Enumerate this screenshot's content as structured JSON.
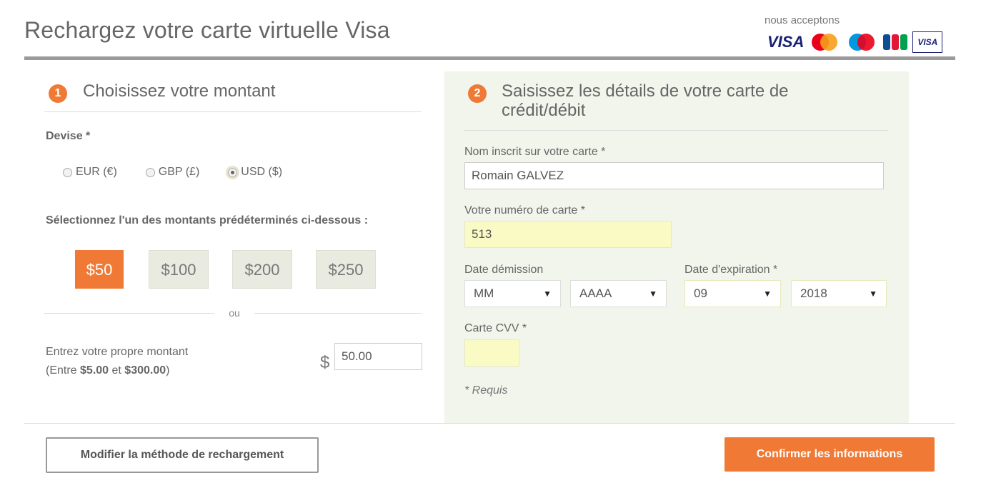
{
  "header": {
    "title": "Rechargez votre carte virtuelle Visa",
    "accept_label": "nous acceptons",
    "cards": [
      "visa-icon",
      "mastercard-icon",
      "maestro-icon",
      "jcb-icon",
      "visa-electron-icon"
    ],
    "card_texts": {
      "visa": "VISA",
      "visa_electron": "VISA"
    }
  },
  "step1": {
    "number": "1",
    "title": "Choisissez votre montant",
    "currency_label": "Devise *",
    "currencies": [
      {
        "label": "EUR (€)",
        "selected": false
      },
      {
        "label": "GBP (£)",
        "selected": false
      },
      {
        "label": "USD ($)",
        "selected": true
      }
    ],
    "preset_label": "Sélectionnez l'un des montants prédéterminés ci-dessous :",
    "presets": [
      {
        "label": "$50",
        "active": true
      },
      {
        "label": "$100",
        "active": false
      },
      {
        "label": "$200",
        "active": false
      },
      {
        "label": "$250",
        "active": false
      }
    ],
    "or_text": "ou",
    "custom_label": "Entrez votre propre montant",
    "custom_range_prefix": "(Entre ",
    "custom_min": "$5.00",
    "custom_range_mid": " et ",
    "custom_max": "$300.00",
    "custom_range_suffix": ")",
    "currency_symbol": "$",
    "custom_value": "50.00"
  },
  "step2": {
    "number": "2",
    "title_line1": "Saisissez les détails de votre carte de",
    "title_line2": "crédit/débit",
    "name_label": "Nom inscrit sur votre carte *",
    "name_value": "Romain GALVEZ",
    "number_label": "Votre numéro de carte *",
    "number_value": "513",
    "issue_label": "Date démission",
    "issue_month": "MM",
    "issue_year": "AAAA",
    "expiry_label": "Date d'expiration *",
    "expiry_month": "09",
    "expiry_year": "2018",
    "cvv_label": "Carte CVV *",
    "required_note": "* Requis"
  },
  "actions": {
    "modify_label": "Modifier la méthode de rechargement",
    "confirm_label": "Confirmer les informations"
  },
  "colors": {
    "accent": "#f07a35",
    "panel": "#f1f5ec",
    "autofill": "#fafbc4"
  }
}
